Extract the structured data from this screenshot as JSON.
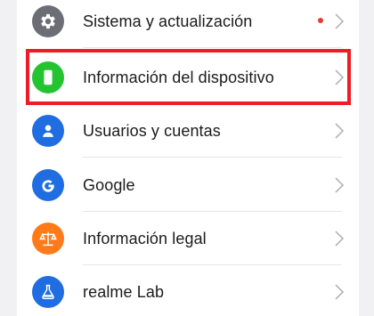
{
  "settings": {
    "items": [
      {
        "label": "Sistema y actualización",
        "icon": "gear-icon",
        "color": "#6b6f75",
        "badge": true
      },
      {
        "label": "Información del dispositivo",
        "icon": "phone-icon",
        "color": "#24c431",
        "badge": false
      },
      {
        "label": "Usuarios y cuentas",
        "icon": "user-icon",
        "color": "#1f6de0",
        "badge": false
      },
      {
        "label": "Google",
        "icon": "google-icon",
        "color": "#1f6de0",
        "badge": false
      },
      {
        "label": "Información legal",
        "icon": "scales-icon",
        "color": "#ff7a1a",
        "badge": false
      },
      {
        "label": "realme Lab",
        "icon": "flask-icon",
        "color": "#1f6de0",
        "badge": false
      }
    ]
  },
  "highlight": {
    "color": "#ee1c25",
    "target": "Información del dispositivo"
  }
}
